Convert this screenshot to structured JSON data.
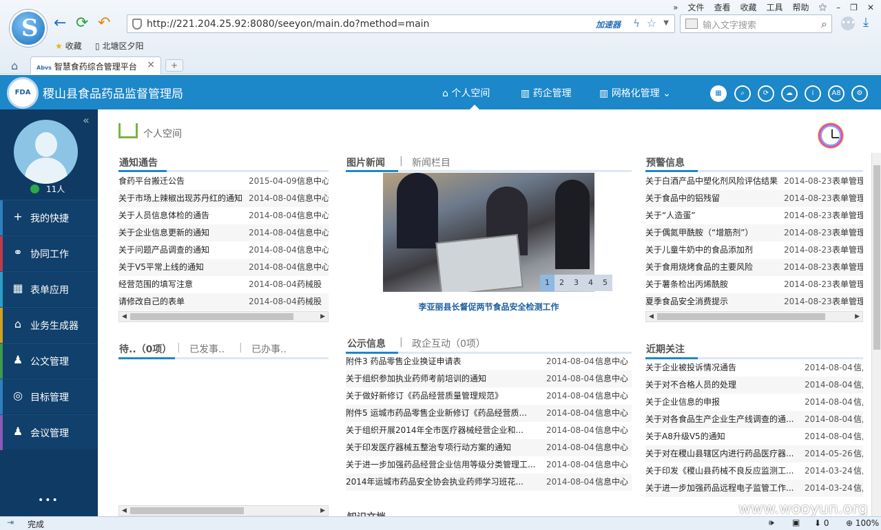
{
  "browser": {
    "url": "http://221.204.25.92:8080/seeyon/main.do?method=main",
    "accelerator": "加速器",
    "search_placeholder": "输入文字搜索",
    "menu": [
      "文件",
      "查看",
      "收藏",
      "工具",
      "帮助"
    ],
    "bookmarks": [
      "收藏",
      "北塘区夕阳"
    ],
    "tab_title": "智慧食药综合管理平台",
    "tab_favicon": "Abvs",
    "status": "完成",
    "status_right": [
      "0",
      "100%"
    ]
  },
  "app": {
    "title": "稷山县食品药品监督管理局",
    "logo_text": "FDA",
    "nav": [
      "个人空间",
      "药企管理",
      "网格化管理"
    ],
    "icon_a8": "A8"
  },
  "sidebar": {
    "online_count": "11人",
    "items": [
      {
        "label": "我的快捷",
        "color": "#2f7fc1",
        "icon": "+"
      },
      {
        "label": "协同工作",
        "color": "#c23a4a",
        "icon": "⚭"
      },
      {
        "label": "表单应用",
        "color": "#2aa0c8",
        "icon": "▦"
      },
      {
        "label": "业务生成器",
        "color": "#d4a020",
        "icon": "⌂"
      },
      {
        "label": "公文管理",
        "color": "#3e9a4a",
        "icon": "♟"
      },
      {
        "label": "目标管理",
        "color": "#2f7fc1",
        "icon": "◎"
      },
      {
        "label": "会议管理",
        "color": "#8a5ab8",
        "icon": "♟"
      }
    ],
    "more": "•••"
  },
  "breadcrumb": "个人空间",
  "notice": {
    "title": "通知通告",
    "rows": [
      {
        "t": "食药平台搬迁公告",
        "d": "2015-04-09",
        "s": "信息中心"
      },
      {
        "t": "关于市场上辣椒出现苏丹红的通知",
        "d": "2014-08-04",
        "s": "信息中心"
      },
      {
        "t": "关于人员信息体检的通告",
        "d": "2014-08-04",
        "s": "信息中心"
      },
      {
        "t": "关于企业信息更新的通知",
        "d": "2014-08-04",
        "s": "信息中心"
      },
      {
        "t": "关于问题产品调查的通知",
        "d": "2014-08-04",
        "s": "信息中心"
      },
      {
        "t": "关于V5平常上线的通知",
        "d": "2014-08-04",
        "s": "信息中心"
      },
      {
        "t": "经营范围的填写注意",
        "d": "2014-08-04",
        "s": "药械股"
      },
      {
        "t": "请修改自己的表单",
        "d": "2014-08-04",
        "s": "药械股"
      }
    ]
  },
  "pending": {
    "tabs": [
      "待..（0项）",
      "已发事..",
      "已办事.."
    ]
  },
  "photo_news": {
    "title": "图片新闻",
    "tab2": "新闻栏目",
    "caption": "李亚丽县长督促两节食品安全检测工作",
    "pages": [
      "1",
      "2",
      "3",
      "4",
      "5"
    ]
  },
  "public_info": {
    "title": "公示信息",
    "tab2": "政企互动（0项）",
    "rows": [
      {
        "t": "附件3 药品零售企业换证申请表",
        "d": "2014-08-04",
        "s": "信息中心"
      },
      {
        "t": "关于组织参加执业药师考前培训的通知",
        "d": "2014-08-04",
        "s": "信息中心"
      },
      {
        "t": "关于做好新修订《药品经营质量管理规范》",
        "d": "2014-08-04",
        "s": "信息中心"
      },
      {
        "t": "附件5 运城市药品零售企业新修订《药品经营质...",
        "d": "2014-08-04",
        "s": "信息中心"
      },
      {
        "t": "关于组织开展2014年全市医疗器械经营企业和...",
        "d": "2014-08-04",
        "s": "信息中心"
      },
      {
        "t": "关于印发医疗器械五整治专项行动方案的通知",
        "d": "2014-08-04",
        "s": "信息中心"
      },
      {
        "t": "关于进一步加强药品经营企业信用等级分类管理工...",
        "d": "2014-08-04",
        "s": "信息中心"
      },
      {
        "t": "2014年运城市药品安全协会执业药师学习班花...",
        "d": "2014-08-04",
        "s": "信息中心"
      }
    ],
    "next_section": "知识文档"
  },
  "warning": {
    "title": "预警信息",
    "rows": [
      {
        "t": "关于白酒产品中塑化剂风险评估结果",
        "d": "2014-08-23",
        "s": "表单管理"
      },
      {
        "t": "关于食品中的铝残留",
        "d": "2014-08-23",
        "s": "表单管理"
      },
      {
        "t": "关于“人造蛋”",
        "d": "2014-08-23",
        "s": "表单管理"
      },
      {
        "t": "关于偶氮甲酰胺（“增筋剂”）",
        "d": "2014-08-23",
        "s": "表单管理"
      },
      {
        "t": "关于儿童牛奶中的食品添加剂",
        "d": "2014-08-23",
        "s": "表单管理"
      },
      {
        "t": "关于食用烧烤食品的主要风险",
        "d": "2014-08-23",
        "s": "表单管理"
      },
      {
        "t": "关于薯条检出丙烯酰胺",
        "d": "2014-08-23",
        "s": "表单管理"
      },
      {
        "t": "夏季食品安全消费提示",
        "d": "2014-08-23",
        "s": "表单管理"
      }
    ]
  },
  "recent": {
    "title": "近期关注",
    "rows": [
      {
        "t": "关于企业被投诉情况通告",
        "d": "2014-08-04",
        "s": "信,"
      },
      {
        "t": "关于对不合格人员的处理",
        "d": "2014-08-04",
        "s": "信,"
      },
      {
        "t": "关于企业信息的申报",
        "d": "2014-08-04",
        "s": "信,"
      },
      {
        "t": "关于对各食品生产企业生产线调查的通...",
        "d": "2014-08-04",
        "s": "信,"
      },
      {
        "t": "关于A8升级V5的通知",
        "d": "2014-08-04",
        "s": "信,"
      },
      {
        "t": "关于对在稷山县辖区内进行药品医疗器...",
        "d": "2014-05-26",
        "s": "信,"
      },
      {
        "t": "关于印发《稷山县药械不良反应监测工...",
        "d": "2014-03-24",
        "s": "信,"
      },
      {
        "t": "关于进一步加强药品远程电子监管工作...",
        "d": "2014-03-24",
        "s": "信,"
      }
    ]
  },
  "watermark": "www.wooyun.org"
}
